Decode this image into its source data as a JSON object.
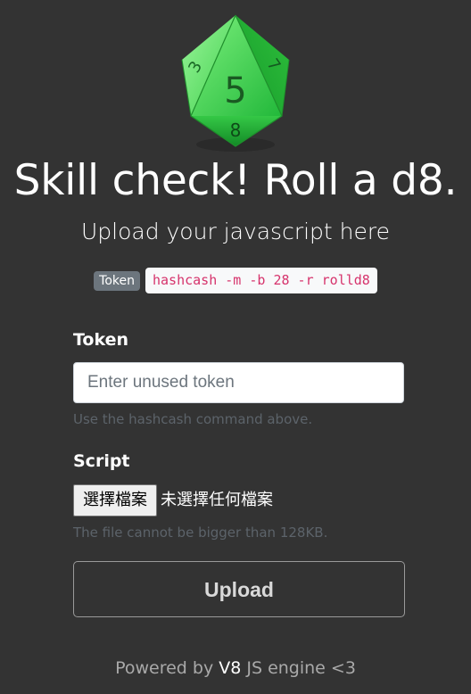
{
  "logo": {
    "icon": "d8-die-icon",
    "faces": {
      "front": "5",
      "left": "3",
      "right": "7",
      "bottom": "8"
    },
    "color": "#3dd64a"
  },
  "header": {
    "title": "Skill check! Roll a d8.",
    "subtitle": "Upload your javascript here"
  },
  "token_hint": {
    "badge": "Token",
    "command": "hashcash -m -b 28 -r rolld8"
  },
  "form": {
    "token_label": "Token",
    "token_placeholder": "Enter unused token",
    "token_value": "",
    "token_help": "Use the hashcash command above.",
    "script_label": "Script",
    "file_button_label": "選擇檔案",
    "file_status": "未選擇任何檔案",
    "script_help": "The file cannot be bigger than 128KB.",
    "upload_label": "Upload"
  },
  "footer": {
    "prefix": "Powered by ",
    "engine": "V8",
    "suffix": " JS engine <3"
  },
  "colors": {
    "background": "#333333",
    "badge": "#6c757d",
    "code_text": "#d6336c",
    "help_text": "#5c636a"
  }
}
